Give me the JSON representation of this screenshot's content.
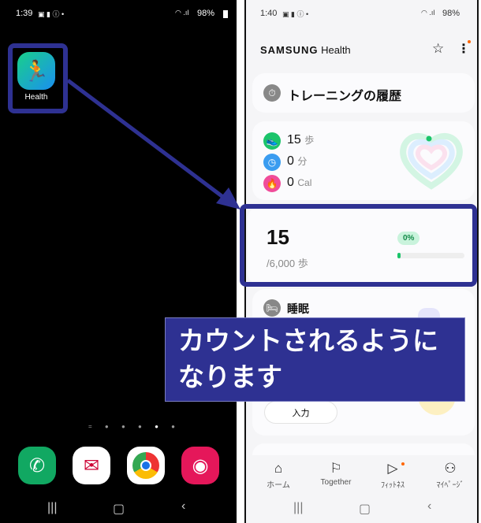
{
  "left_phone": {
    "status": {
      "time": "1:39",
      "battery": "98%"
    },
    "app": {
      "label": "Health",
      "icon": "samsung-health-icon"
    },
    "dock": [
      {
        "name": "phone",
        "icon": "phone-icon",
        "color": "#11a862"
      },
      {
        "name": "mail",
        "icon": "mail-icon",
        "color": "#ffffff"
      },
      {
        "name": "chrome",
        "icon": "chrome-icon",
        "color": "#ffffff"
      },
      {
        "name": "camera",
        "icon": "camera-icon",
        "color": "#e5175a"
      }
    ],
    "page_indicator": {
      "pages": 5,
      "current": 4
    }
  },
  "right_phone": {
    "status": {
      "time": "1:40",
      "battery": "98%"
    },
    "header": {
      "title_brand": "SAMSUNG",
      "title_app": "Health"
    },
    "training": {
      "label": "トレーニングの履歴"
    },
    "activity": {
      "steps_value": "15",
      "steps_unit": "歩",
      "minutes_value": "0",
      "minutes_unit": "分",
      "cal_value": "0",
      "cal_unit": "Cal"
    },
    "steps_card": {
      "count": "15",
      "goal": "/6,000 歩",
      "percent_label": "0%",
      "progress": 0.0025
    },
    "sleep": {
      "label": "睡眠",
      "input_button": "入力"
    },
    "bottom_nav": [
      {
        "label": "ホーム",
        "icon": "home-icon",
        "active": true
      },
      {
        "label": "Together",
        "icon": "flag-icon"
      },
      {
        "label": "ﾌｨｯﾄﾈｽ",
        "icon": "fitness-icon"
      },
      {
        "label": "ﾏｲﾍﾟｰｼﾞ",
        "icon": "person-icon"
      }
    ]
  },
  "annotation": {
    "caption": "カウントされるようになります",
    "color": "#2e3192"
  }
}
